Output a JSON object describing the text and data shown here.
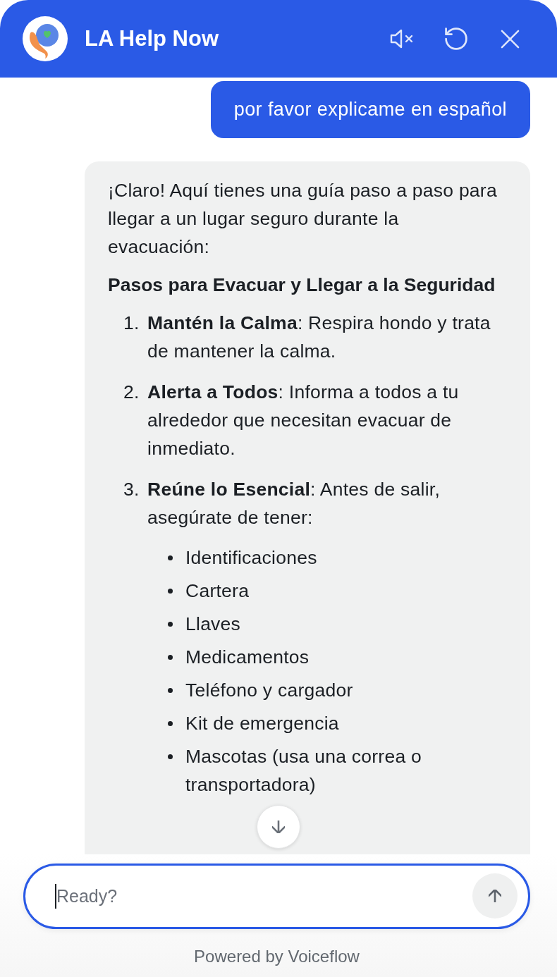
{
  "header": {
    "title": "LA Help Now"
  },
  "messages": [
    {
      "kind": "user",
      "text": "por favor explicame en español"
    },
    {
      "kind": "bot",
      "blocks": [
        {
          "kind": "paragraph",
          "text": "¡Claro! Aquí tienes una guía paso a paso para llegar a un lugar seguro durante la evacuación:"
        },
        {
          "kind": "heading",
          "text": "Pasos para Evacuar y Llegar a la Seguridad"
        },
        {
          "kind": "ordered_list",
          "items": [
            {
              "number": "1.",
              "text": "**Mantén la Calma**: Respira hondo y trata de mantener la calma."
            },
            {
              "number": "2.",
              "text": "**Alerta a Todos**: Informa a todos a tu alrededor que necesitan evacuar de inmediato."
            },
            {
              "number": "3.",
              "text": "**Reúne lo Esencial**: Antes de salir, asegúrate de tener:",
              "children": [
                {
                  "text": "Identificaciones"
                },
                {
                  "text": "Cartera"
                },
                {
                  "text": "Llaves"
                },
                {
                  "text": "Medicamentos"
                },
                {
                  "text": "Teléfono y cargador"
                },
                {
                  "text": "Kit de emergencia"
                },
                {
                  "text": "Mascotas (usa una correa o transportadora)"
                }
              ]
            }
          ]
        }
      ]
    }
  ],
  "composer": {
    "placeholder": "Ready?",
    "focused": true
  },
  "footer": {
    "text": "Powered by Voiceflow"
  }
}
